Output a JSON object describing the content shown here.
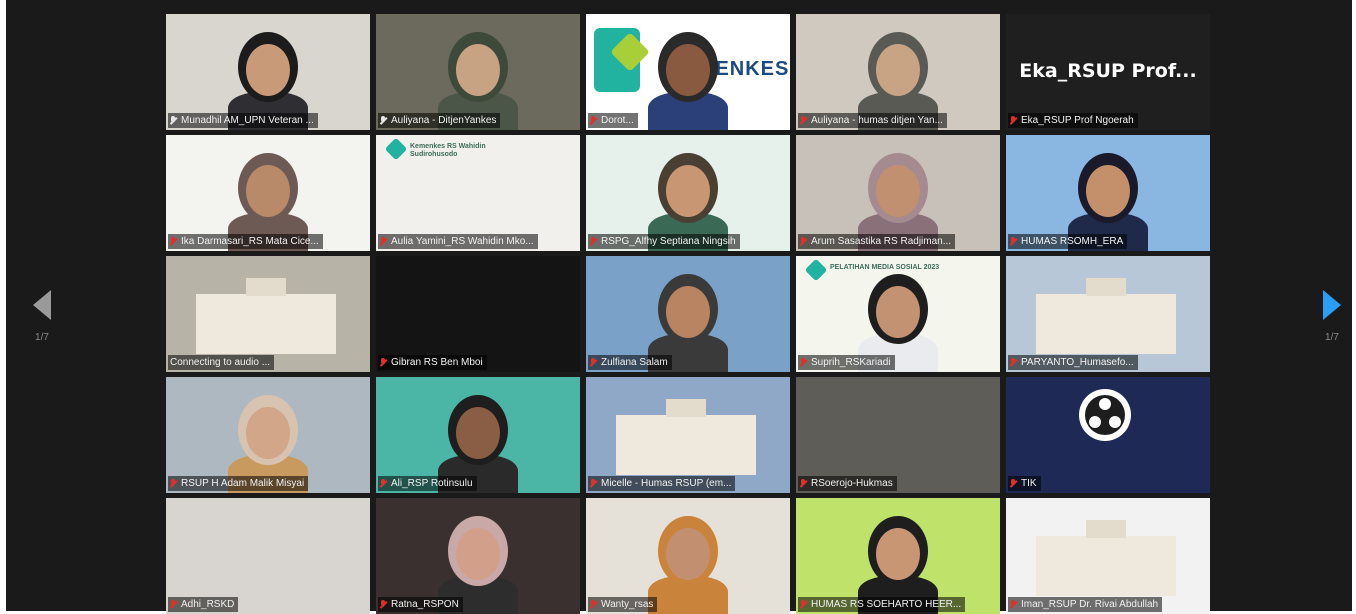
{
  "pager": {
    "left": "1/7",
    "right": "1/7"
  },
  "tiles": [
    {
      "name": "Munadhil AM_UPN Veteran ...",
      "mic": "on",
      "bg": "#d9d6d0",
      "person": true,
      "skin": "#c99a78",
      "hair": "#1c1c1c",
      "shirt": "#2f2f33"
    },
    {
      "name": "Auliyana - DitjenYankes",
      "mic": "on",
      "bg": "#6b6a5c",
      "person": true,
      "skin": "#c7a283",
      "hair": "#3d4a3a",
      "shirt": "#4b5648",
      "active": true
    },
    {
      "name": "Dorot...",
      "mic": "muted",
      "bg": "#ffffff",
      "person": true,
      "skin": "#8a5a40",
      "hair": "#2a2a2a",
      "shirt": "#2b3f78",
      "logo": "KEMENKES"
    },
    {
      "name": "Auliyana - humas ditjen Yan...",
      "mic": "muted",
      "bg": "#cfc9c0",
      "person": true,
      "skin": "#c9a484",
      "hair": "#5a5a55",
      "shirt": "#5a5a55"
    },
    {
      "name": "Eka_RSUP Prof Ngoerah",
      "mic": "muted",
      "bg": "#1f1f1f",
      "bigtext": "Eka_RSUP  Prof..."
    },
    {
      "name": "Ika Darmasari_RS Mata Cice...",
      "mic": "muted",
      "bg": "#f3f3f0",
      "person": true,
      "skin": "#b88a6a",
      "hair": "#6e5a55",
      "shirt": "#6e5a55"
    },
    {
      "name": "Aulia Yamini_RS Wahidin Mko...",
      "mic": "muted",
      "bg": "#f1f0ec",
      "slide": "Kemenkes RS Wahidin Sudirohusodo"
    },
    {
      "name": "RSPG_Alfhy Septiana Ningsih",
      "mic": "muted",
      "bg": "#e7f1ec",
      "person": true,
      "skin": "#c99674",
      "hair": "#4a3f33",
      "shirt": "#3a6a55"
    },
    {
      "name": "Arum Sasastika RS Radjiman...",
      "mic": "muted",
      "bg": "#c7c1b9",
      "person": true,
      "skin": "#c09070",
      "hair": "#a58a90",
      "shirt": "#8a7078"
    },
    {
      "name": "HUMAS RSOMH_ERA",
      "mic": "muted",
      "bg": "#8ab6e2",
      "person": true,
      "skin": "#c4906c",
      "hair": "#1a1a2a",
      "shirt": "#1f2a4a"
    },
    {
      "name": "Connecting to audio ...",
      "mic": "none",
      "bg": "#b8b3a7",
      "building": true
    },
    {
      "name": "Gibran RS Ben Mboi",
      "mic": "muted",
      "bg": "#141414"
    },
    {
      "name": "Zulfiana Salam",
      "mic": "muted",
      "bg": "#7aa2c8",
      "person": true,
      "skin": "#b88462",
      "hair": "#3a3a3a",
      "shirt": "#3a3a3a"
    },
    {
      "name": "Suprih_RSKariadi",
      "mic": "muted",
      "bg": "#f4f6ee",
      "person": true,
      "skin": "#c29273",
      "hair": "#1e1e1e",
      "shirt": "#e9ebee",
      "slide": "PELATIHAN MEDIA SOSIAL 2023"
    },
    {
      "name": "PARYANTO_Humasefo...",
      "mic": "muted",
      "bg": "#b7c7d8",
      "building": true
    },
    {
      "name": "RSUP H Adam Malik Misyai",
      "mic": "muted",
      "bg": "#aeb8c0",
      "person": true,
      "skin": "#d2a688",
      "hair": "#d8c2b0",
      "shirt": "#c89a60"
    },
    {
      "name": "Ali_RSP Rotinsulu",
      "mic": "muted",
      "bg": "#4bb6a6",
      "person": true,
      "skin": "#8a5e45",
      "hair": "#1e1e1e",
      "shirt": "#2a2a2a"
    },
    {
      "name": "Micelle - Humas RSUP (em...",
      "mic": "muted",
      "bg": "#8fa8c7",
      "building": true
    },
    {
      "name": "RSoerojo-Hukmas",
      "mic": "muted",
      "bg": "#5f5d58"
    },
    {
      "name": "TIK",
      "mic": "muted",
      "bg": "#1e2a55",
      "obs": true
    },
    {
      "name": "Adhi_RSKD",
      "mic": "muted",
      "bg": "#d8d4cf"
    },
    {
      "name": "Ratna_RSPON",
      "mic": "muted",
      "bg": "#3a3030",
      "person": true,
      "skin": "#d2a08a",
      "hair": "#c9a8a8",
      "shirt": "#2d2d2d"
    },
    {
      "name": "Wanty_rsas",
      "mic": "muted",
      "bg": "#e6e1d8",
      "person": true,
      "skin": "#c29070",
      "hair": "#c9833a",
      "shirt": "#c9833a"
    },
    {
      "name": "HUMAS RS SOEHARTO HEER...",
      "mic": "muted",
      "bg": "#bfe26a",
      "person": true,
      "skin": "#c99674",
      "hair": "#1e1e1e",
      "shirt": "#1e1e1e"
    },
    {
      "name": "Iman_RSUP Dr. Rivai Abdullah",
      "mic": "muted",
      "bg": "#f2f2f2",
      "building": true
    }
  ]
}
